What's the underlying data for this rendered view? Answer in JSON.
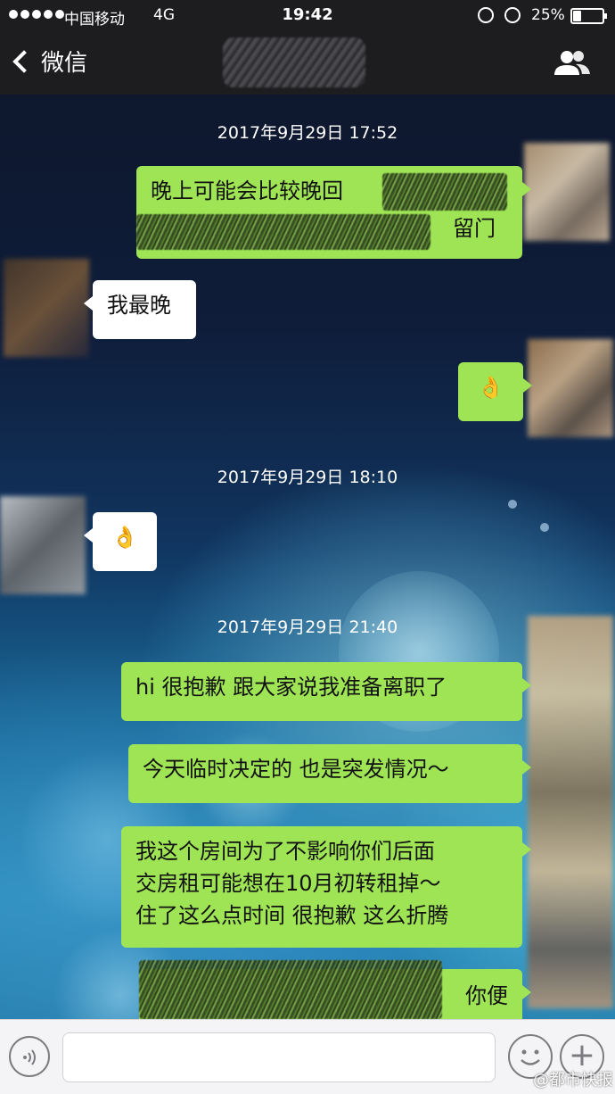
{
  "status_bar": {
    "carrier": "中国移动",
    "network": "4G",
    "time": "19:42",
    "battery": "25%",
    "battery_level": 0.25
  },
  "nav": {
    "back_label": "微信",
    "back_icon": "chevron-left-icon",
    "contacts_icon": "contacts-icon"
  },
  "messages": {
    "ts1": "2017年9月29日 17:52",
    "m1_line1": "晚上可能会比较晚回",
    "m1_tail": "留门",
    "m2": "我最晚",
    "m3_emoji": "👌",
    "ts2": "2017年9月29日 18:10",
    "m4_emoji": "👌",
    "ts3": "2017年9月29日 21:40",
    "m5": "hi 很抱歉 跟大家说我准备离职了",
    "m6": "今天临时决定的 也是突发情况～",
    "m7_line1": "我这个房间为了不影响你们后面",
    "m7_line2": "交房租可能想在10月初转租掉～",
    "m7_line3": "住了这么点时间 很抱歉 这么折腾",
    "m8_tail": "你便"
  },
  "input": {
    "value": "",
    "placeholder": ""
  },
  "watermark": "@都市快报",
  "colors": {
    "my_bubble": "#9ee454",
    "other_bubble": "#ffffff",
    "bar": "#1d1d20"
  }
}
